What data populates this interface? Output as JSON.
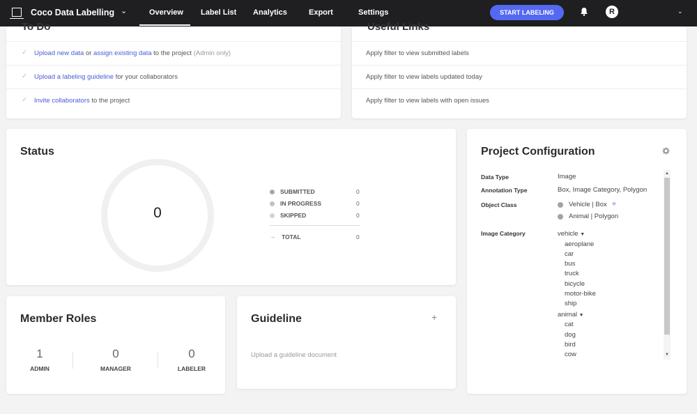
{
  "topbar": {
    "project_name": "Coco Data Labelling",
    "tabs": [
      "Overview",
      "Label List",
      "Analytics",
      "Export",
      "Settings"
    ],
    "start_button": "START LABELING",
    "avatar_initial": "R"
  },
  "todo": {
    "title": "To Do",
    "items": [
      {
        "link1": "Upload new data",
        "mid": " or ",
        "link2": "assign existing data",
        "rest": " to the project ",
        "note": "(Admin only)"
      },
      {
        "link1": "Upload a labeling guideline",
        "rest": " for your collaborators"
      },
      {
        "link1": "Invite collaborators",
        "rest": " to the project"
      }
    ]
  },
  "useful_links": {
    "title": "Useful Links",
    "items": [
      "Apply filter to view submitted labels",
      "Apply filter to view labels updated today",
      "Apply filter to view labels with open issues"
    ]
  },
  "status": {
    "title": "Status",
    "total_center": "0",
    "legend": [
      {
        "label": "SUBMITTED",
        "value": "0",
        "color": "#a8a8ab"
      },
      {
        "label": "IN PROGRESS",
        "value": "0",
        "color": "#c2c2c5"
      },
      {
        "label": "SKIPPED",
        "value": "0",
        "color": "#d3d3d6"
      }
    ],
    "total_label": "TOTAL",
    "total_value": "0"
  },
  "config": {
    "title": "Project Configuration",
    "data_type_label": "Data Type",
    "data_type": "Image",
    "annotation_type_label": "Annotation Type",
    "annotation_type": "Box, Image Category, Polygon",
    "object_class_label": "Object Class",
    "object_classes": [
      "Vehicle  |  Box",
      "Animal  |  Polygon"
    ],
    "image_category_label": "Image Category",
    "category_groups": [
      {
        "name": "vehicle",
        "items": [
          "aeroplane",
          "car",
          "bus",
          "truck",
          "bicycle",
          "motor-bike",
          "ship"
        ]
      },
      {
        "name": "animal",
        "items": [
          "cat",
          "dog",
          "bird",
          "cow"
        ]
      }
    ]
  },
  "members": {
    "title": "Member Roles",
    "roles": [
      {
        "count": "1",
        "label": "ADMIN"
      },
      {
        "count": "0",
        "label": "MANAGER"
      },
      {
        "count": "0",
        "label": "LABELER"
      }
    ]
  },
  "guideline": {
    "title": "Guideline",
    "empty_text": "Upload a guideline document"
  },
  "colors": {
    "topbar_bg": "#1f1f21",
    "accent": "#5468f2",
    "link": "#4a5ad8"
  }
}
